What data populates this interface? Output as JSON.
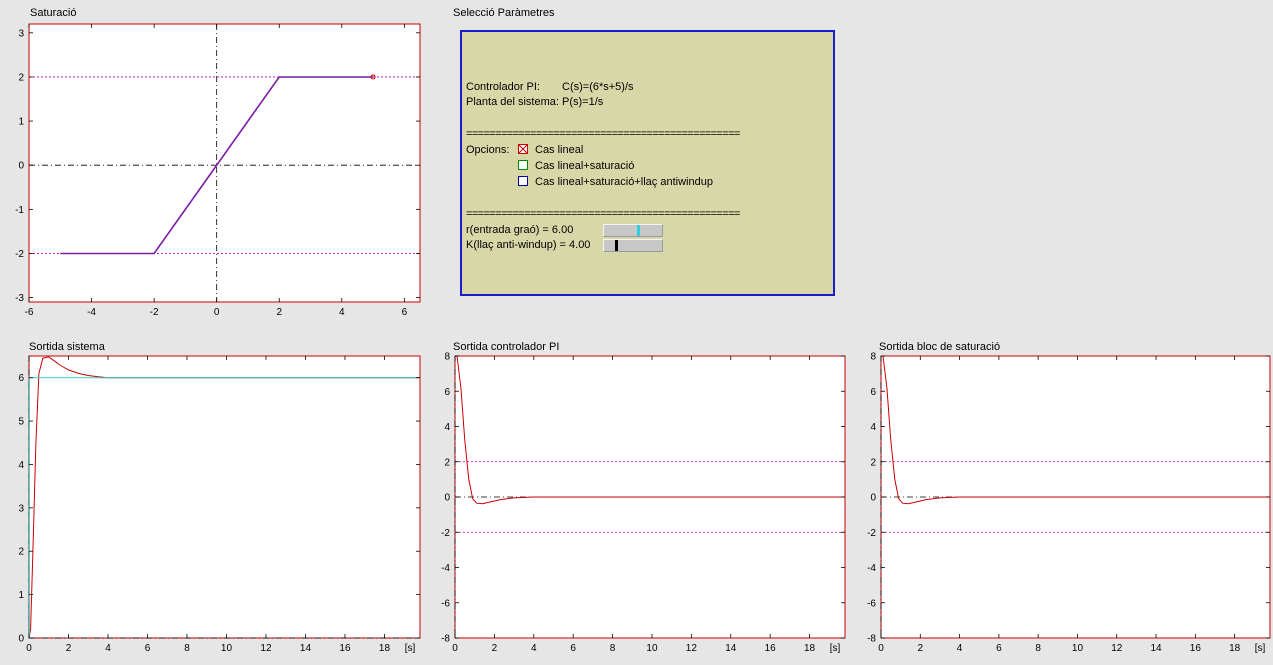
{
  "plots": {
    "saturacio": {
      "title": "Saturació",
      "x_ticks": [
        "-6",
        "-4",
        "-2",
        "0",
        "2",
        "4",
        "6"
      ],
      "y_ticks": [
        "-3",
        "-2",
        "-1",
        "0",
        "1",
        "2",
        "3"
      ]
    },
    "sortida_sistema": {
      "title": "Sortida sistema",
      "x_ticks": [
        "0",
        "2",
        "4",
        "6",
        "8",
        "10",
        "12",
        "14",
        "16",
        "18"
      ],
      "x_unit": "[s]",
      "y_ticks": [
        "0",
        "1",
        "2",
        "3",
        "4",
        "5",
        "6"
      ]
    },
    "sortida_controlador": {
      "title": "Sortida controlador PI",
      "x_ticks": [
        "0",
        "2",
        "4",
        "6",
        "8",
        "10",
        "12",
        "14",
        "16",
        "18"
      ],
      "x_unit": "[s]",
      "y_ticks": [
        "-8",
        "-6",
        "-4",
        "-2",
        "0",
        "2",
        "4",
        "6",
        "8"
      ]
    },
    "sortida_saturacio": {
      "title": "Sortida bloc de saturació",
      "x_ticks": [
        "0",
        "2",
        "4",
        "6",
        "8",
        "10",
        "12",
        "14",
        "16",
        "18"
      ],
      "x_unit": "[s]",
      "y_ticks": [
        "-8",
        "-6",
        "-4",
        "-2",
        "0",
        "2",
        "4",
        "6",
        "8"
      ]
    }
  },
  "params": {
    "title": "Selecció Paràmetres",
    "controlador_label": "Controlador PI:",
    "controlador_value": "C(s)=(6*s+5)/s",
    "planta_label": "Planta del sistema:",
    "planta_value": "P(s)=1/s",
    "separator": "===============================================",
    "opcions_label": "Opcions:",
    "options": [
      {
        "label": "Cas lineal",
        "checked": true,
        "color": "#cc0000"
      },
      {
        "label": "Cas lineal+saturació",
        "checked": false,
        "color": "#008800"
      },
      {
        "label": "Cas lineal+saturació+llaç antiwindup",
        "checked": false,
        "color": "#0000aa"
      }
    ],
    "r_label": "r(entrada graó) = 6.00",
    "r_fraction": 0.6,
    "k_label": "K(llaç anti-windup) = 4.00",
    "k_fraction": 0.2,
    "colors": {
      "panel_border": "#1b1bd0",
      "panel_bg": "#d8d7a8",
      "r_thumb": "#33ccdd",
      "k_thumb": "#000000"
    }
  },
  "chart_data": [
    {
      "type": "line",
      "title": "Saturació",
      "xlim": [
        -6,
        6.5
      ],
      "ylim": [
        -3.1,
        3.2
      ],
      "series": [
        {
          "x": [
            -5,
            -2,
            2,
            5
          ],
          "y": [
            -2,
            -2,
            2,
            2
          ]
        }
      ],
      "reference_lines": {
        "y": [
          2,
          -2
        ]
      }
    },
    {
      "type": "line",
      "title": "Sortida sistema",
      "xlim": [
        0,
        19.8
      ],
      "ylim": [
        0,
        6.5
      ],
      "series": [
        {
          "x": [
            0,
            0.08,
            0.2,
            0.35,
            0.5,
            0.7,
            1,
            1.3,
            1.6,
            2,
            2.5,
            3,
            3.5,
            4,
            5,
            19.8
          ],
          "y": [
            0,
            0.2,
            2,
            4.5,
            6.1,
            6.45,
            6.48,
            6.38,
            6.28,
            6.18,
            6.1,
            6.05,
            6.02,
            6,
            6,
            6
          ]
        },
        {
          "x": [
            0,
            0.02,
            0.02,
            19.8
          ],
          "y": [
            0,
            0,
            6,
            6
          ]
        }
      ]
    },
    {
      "type": "line",
      "title": "Sortida controlador PI",
      "xlim": [
        0,
        19.8
      ],
      "ylim": [
        -8,
        8
      ],
      "series": [
        {
          "x": [
            0.1,
            0.3,
            0.5,
            0.7,
            0.9,
            1.1,
            1.4,
            1.8,
            2.3,
            3,
            4,
            19.8
          ],
          "y": [
            8,
            6.2,
            3.2,
            1.0,
            -0.1,
            -0.35,
            -0.38,
            -0.28,
            -0.15,
            -0.05,
            0,
            0
          ]
        }
      ],
      "reference_lines": {
        "y": [
          2,
          -2
        ]
      }
    },
    {
      "type": "line",
      "title": "Sortida bloc de saturació",
      "xlim": [
        0,
        19.8
      ],
      "ylim": [
        -8,
        8
      ],
      "series": [
        {
          "x": [
            0.1,
            0.3,
            0.5,
            0.7,
            0.9,
            1.1,
            1.4,
            1.8,
            2.3,
            3,
            4,
            19.8
          ],
          "y": [
            8,
            6.2,
            3.2,
            1.0,
            -0.1,
            -0.35,
            -0.38,
            -0.28,
            -0.15,
            -0.05,
            0,
            0
          ]
        }
      ],
      "reference_lines": {
        "y": [
          2,
          -2
        ]
      }
    }
  ]
}
